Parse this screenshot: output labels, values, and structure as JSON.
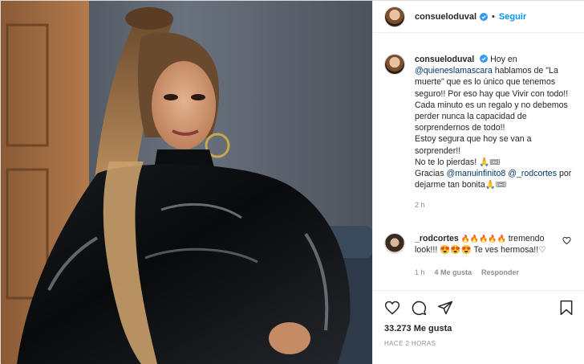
{
  "header": {
    "username": "consueloduval",
    "separator": "•",
    "follow_label": "Seguir"
  },
  "caption": {
    "username": "consueloduval",
    "line1_pre": "Hoy en",
    "mention1": "@quieneslamascara",
    "line2": "hablamos de \"La muerte\" que es lo único que tenemos seguro!! Por eso hay que Vivir con todo!! Cada minuto es un regalo y no debemos perder nunca la capacidad de sorprendernos de todo!!",
    "line3": "Estoy segura que hoy se van a sorprender!!",
    "line4": "No te lo pierdas! 🙏🎟",
    "line5_pre": "Gracias",
    "mention2": "@manuinfinito8",
    "mention3": "@_rodcortes",
    "line6": "por dejarme tan bonita🙏🎟",
    "time": "2 h"
  },
  "reply": {
    "username": "_rodcortes",
    "emojis": "🔥🔥🔥🔥🔥",
    "text": "tremendo look!!! 😍😍😍 Te ves hermosa!!♡",
    "time": "1 h",
    "likes": "4 Me gusta",
    "reply_label": "Responder"
  },
  "actions": {
    "likes_count": "33.273 Me gusta",
    "time_ago": "HACE 2 HORAS"
  },
  "colors": {
    "accent": "#0095f6",
    "mention": "#00376b",
    "muted": "#8e8e8e"
  },
  "icons": [
    "verified-badge-icon",
    "heart-icon",
    "comment-icon",
    "share-icon",
    "save-icon"
  ]
}
